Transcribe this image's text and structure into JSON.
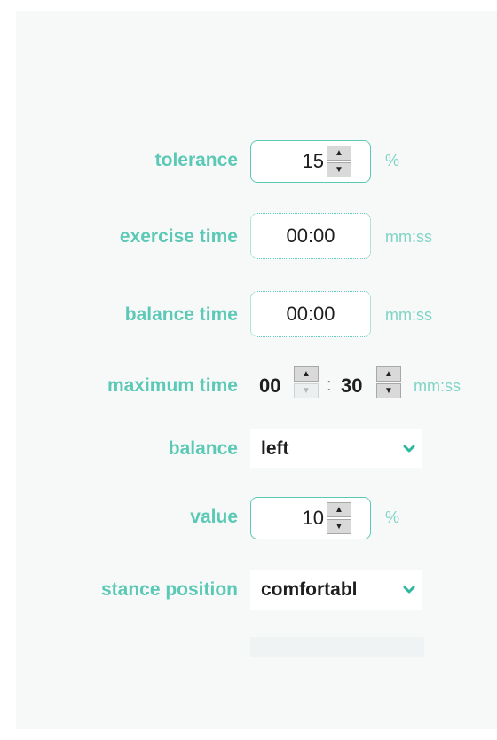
{
  "form": {
    "tolerance": {
      "label": "tolerance",
      "value": "15",
      "unit": "%"
    },
    "exercise_time": {
      "label": "exercise time",
      "value": "00:00",
      "unit": "mm:ss"
    },
    "balance_time": {
      "label": "balance time",
      "value": "00:00",
      "unit": "mm:ss"
    },
    "maximum_time": {
      "label": "maximum time",
      "minutes": "00",
      "separator": ":",
      "seconds": "30",
      "unit": "mm:ss"
    },
    "balance": {
      "label": "balance",
      "selected": "left"
    },
    "value": {
      "label": "value",
      "value": "10",
      "unit": "%"
    },
    "stance_position": {
      "label": "stance position",
      "selected": "comfortabl"
    }
  },
  "icons": {
    "spin_up": "triangle-up-icon",
    "spin_down": "triangle-down-icon",
    "dropdown": "chevron-down-icon"
  },
  "colors": {
    "accent": "#5cc9b6",
    "unit": "#7fd4c4",
    "panel": "#f7f9f9"
  }
}
